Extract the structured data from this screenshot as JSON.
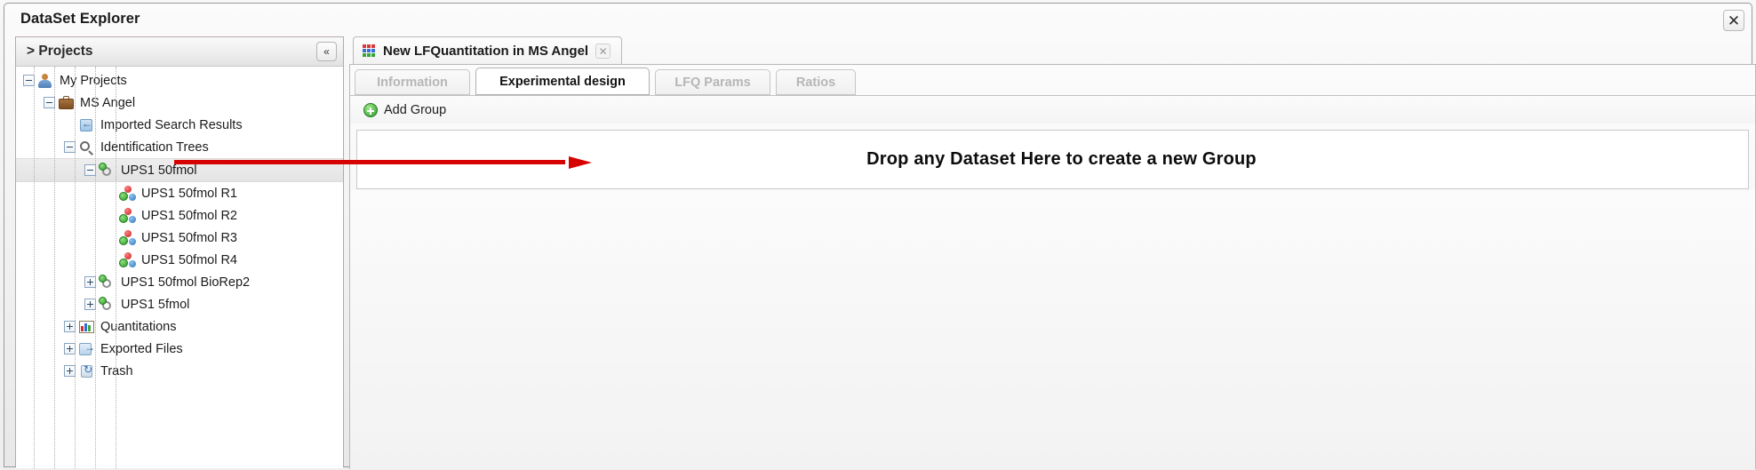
{
  "window": {
    "title": "DataSet Explorer",
    "close_label": "✕"
  },
  "explorer": {
    "header_title": "> Projects",
    "collapse_label": "«",
    "tree": [
      {
        "label": "My Projects",
        "icon": "person-icon",
        "toggle": "minus",
        "depth": 0,
        "selected": false
      },
      {
        "label": "MS Angel",
        "icon": "briefcase-icon",
        "toggle": "minus",
        "depth": 1,
        "selected": false
      },
      {
        "label": "Imported Search Results",
        "icon": "import-icon",
        "toggle": "none",
        "depth": 2,
        "selected": false
      },
      {
        "label": "Identification Trees",
        "icon": "search-icon",
        "toggle": "minus",
        "depth": 2,
        "selected": false
      },
      {
        "label": "UPS1 50fmol",
        "icon": "id-tree-icon",
        "toggle": "minus",
        "depth": 3,
        "selected": true
      },
      {
        "label": "UPS1 50fmol R1",
        "icon": "molecule-icon",
        "toggle": "none",
        "depth": 4,
        "selected": false
      },
      {
        "label": "UPS1 50fmol R2",
        "icon": "molecule-icon",
        "toggle": "none",
        "depth": 4,
        "selected": false
      },
      {
        "label": "UPS1 50fmol R3",
        "icon": "molecule-icon",
        "toggle": "none",
        "depth": 4,
        "selected": false
      },
      {
        "label": "UPS1 50fmol R4",
        "icon": "molecule-icon",
        "toggle": "none",
        "depth": 4,
        "selected": false
      },
      {
        "label": "UPS1 50fmol BioRep2",
        "icon": "id-tree-icon",
        "toggle": "plus",
        "depth": 3,
        "selected": false
      },
      {
        "label": "UPS1 5fmol",
        "icon": "id-tree-icon",
        "toggle": "plus",
        "depth": 3,
        "selected": false
      },
      {
        "label": "Quantitations",
        "icon": "chart-icon",
        "toggle": "plus",
        "depth": 2,
        "selected": false
      },
      {
        "label": "Exported Files",
        "icon": "export-icon",
        "toggle": "plus",
        "depth": 2,
        "selected": false
      },
      {
        "label": "Trash",
        "icon": "trash-icon",
        "toggle": "plus",
        "depth": 2,
        "selected": false
      }
    ]
  },
  "document_tab": {
    "title": "New LFQuantitation in MS Angel",
    "icon": "grid-dots-icon",
    "close_label": "✕"
  },
  "tabs": [
    {
      "label": "Information",
      "active": false,
      "enabled": false
    },
    {
      "label": "Experimental design",
      "active": true,
      "enabled": true
    },
    {
      "label": "LFQ Params",
      "active": false,
      "enabled": false
    },
    {
      "label": "Ratios",
      "active": false,
      "enabled": false
    }
  ],
  "toolbar": {
    "add_group_label": "Add Group",
    "add_group_icon": "green-plus-icon"
  },
  "dropzone": {
    "text": "Drop any Dataset Here to create a new Group"
  },
  "annotation": {
    "arrow_color": "#d60000",
    "arrow_name": "red-pointer-arrow"
  }
}
